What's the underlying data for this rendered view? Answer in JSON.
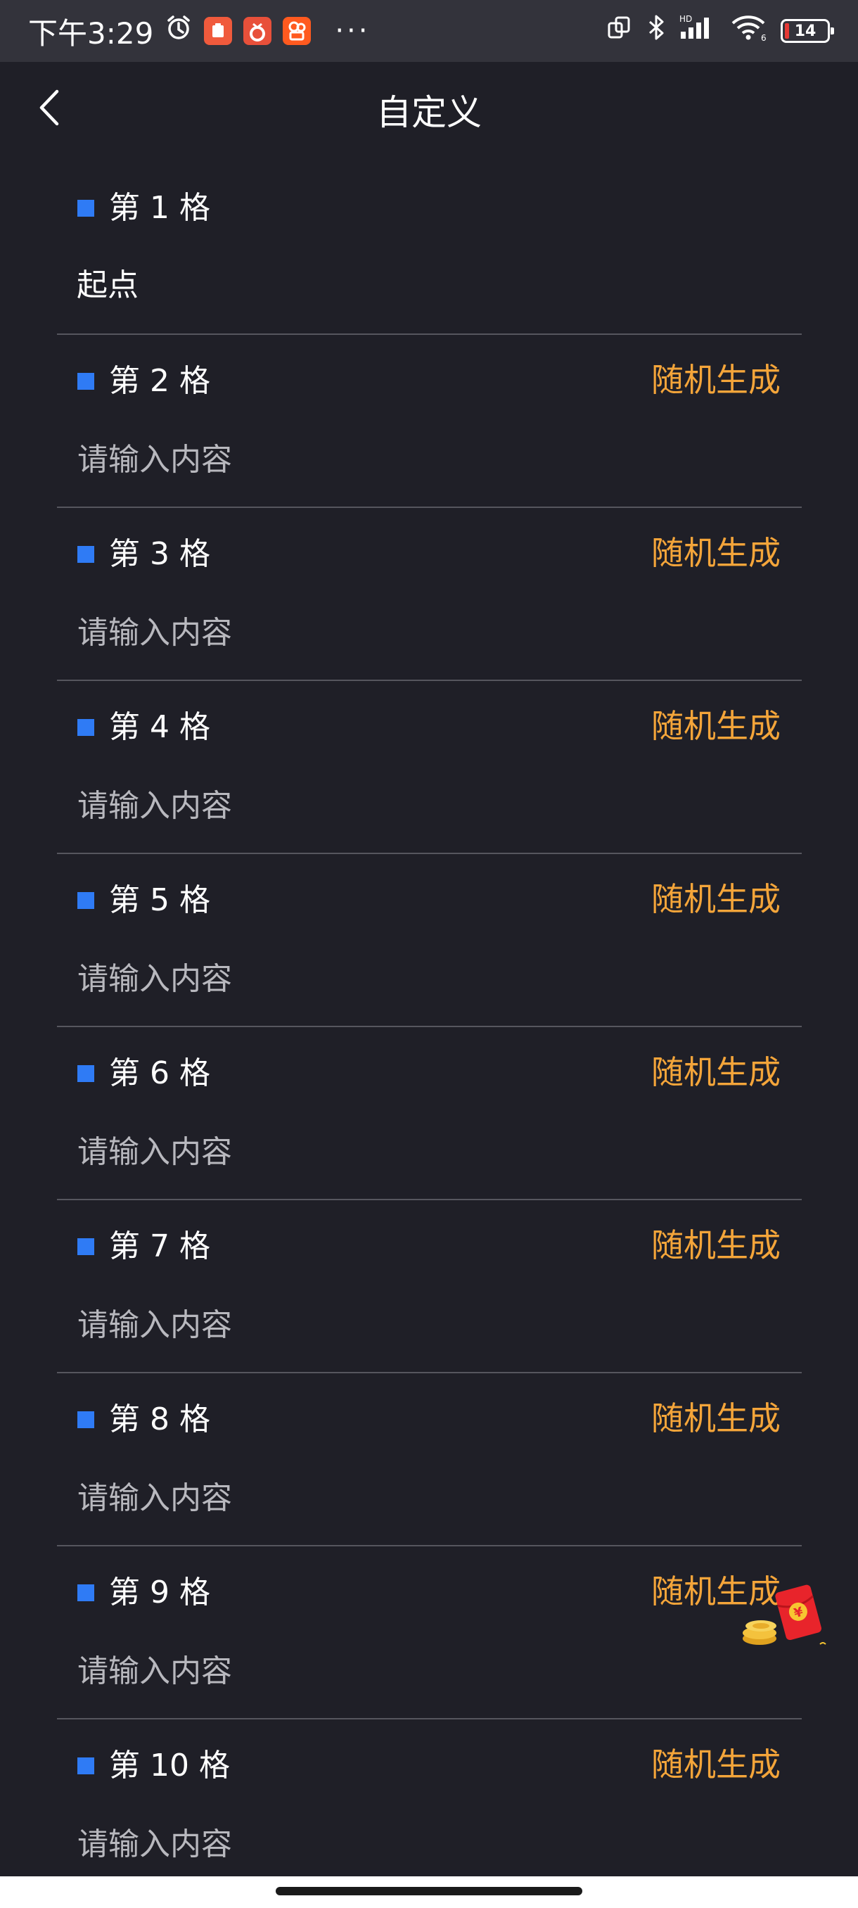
{
  "status_bar": {
    "time": "下午3:29",
    "battery": "14",
    "network_label": "HD",
    "wifi_label": "6",
    "more": "···"
  },
  "header": {
    "title": "自定义"
  },
  "cells": [
    {
      "label": "第 1 格",
      "value": "起点"
    },
    {
      "label": "第 2 格",
      "placeholder": "请输入内容",
      "random_label": "随机生成"
    },
    {
      "label": "第 3 格",
      "placeholder": "请输入内容",
      "random_label": "随机生成"
    },
    {
      "label": "第 4 格",
      "placeholder": "请输入内容",
      "random_label": "随机生成"
    },
    {
      "label": "第 5 格",
      "placeholder": "请输入内容",
      "random_label": "随机生成"
    },
    {
      "label": "第 6 格",
      "placeholder": "请输入内容",
      "random_label": "随机生成"
    },
    {
      "label": "第 7 格",
      "placeholder": "请输入内容",
      "random_label": "随机生成"
    },
    {
      "label": "第 8 格",
      "placeholder": "请输入内容",
      "random_label": "随机生成"
    },
    {
      "label": "第 9 格",
      "placeholder": "请输入内容",
      "random_label": "随机生成"
    },
    {
      "label": "第 10 格",
      "placeholder": "请输入内容",
      "random_label": "随机生成"
    }
  ],
  "colors": {
    "background": "#1f1f27",
    "accent": "#f4a53a",
    "marker": "#2f7bf5",
    "divider": "#56565e"
  },
  "floating": {
    "icon": "red-packet-icon",
    "symbol": "¥"
  }
}
